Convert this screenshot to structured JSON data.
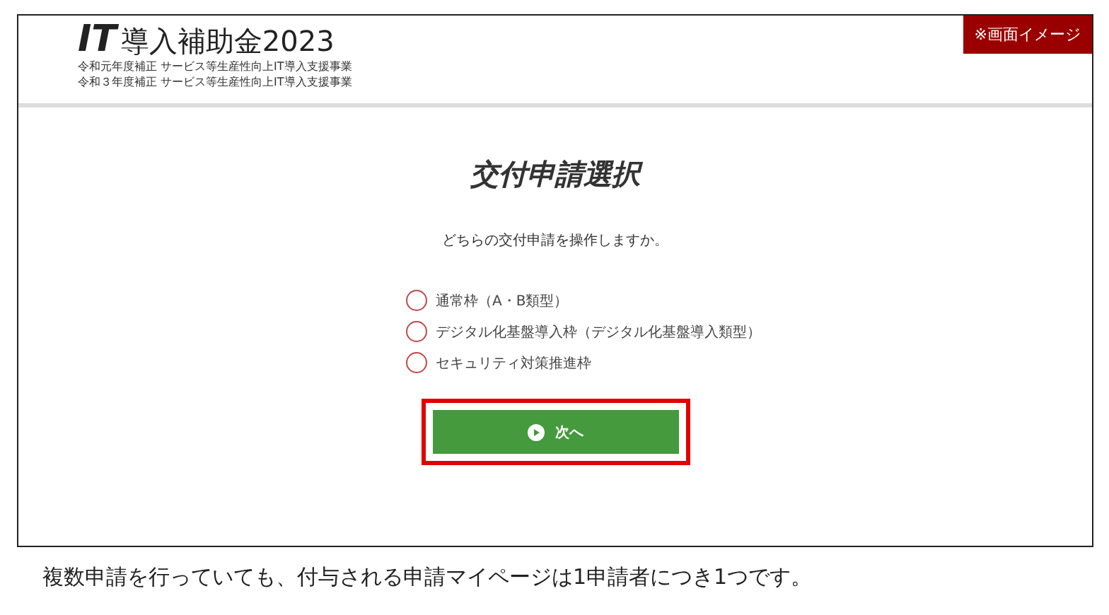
{
  "header": {
    "logo_mark": "IT",
    "logo_text": "導入補助金2023",
    "sublines": [
      "令和元年度補正 サービス等生産性向上IT導入支援事業",
      "令和３年度補正 サービス等生産性向上IT導入支援事業"
    ],
    "badge": "※画面イメージ"
  },
  "title": "交付申請選択",
  "question": "どちらの交付申請を操作しますか。",
  "options": [
    {
      "label": "通常枠（A・B類型）",
      "selected": false
    },
    {
      "label": "デジタル化基盤導入枠（デジタル化基盤導入類型）",
      "selected": false
    },
    {
      "label": "セキュリティ対策推進枠",
      "selected": false
    }
  ],
  "next_button": {
    "label": "次へ",
    "highlighted": true
  },
  "caption": "複数申請を行っていても、付与される申請マイページは1申請者につき1つです。"
}
